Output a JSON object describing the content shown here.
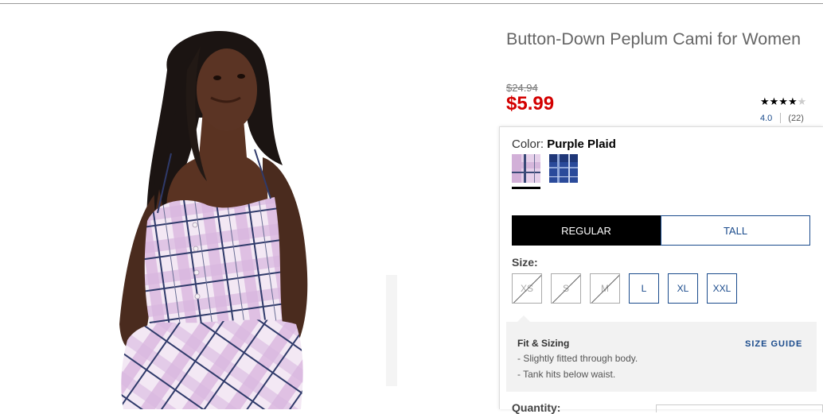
{
  "product": {
    "title": "Button-Down Peplum Cami for Women",
    "old_price": "$24.94",
    "sale_price": "$5.99",
    "rating": {
      "stars_value": 4.0,
      "stars_filled": "★★★★",
      "stars_empty": "★",
      "value_text": "4.0",
      "count_text": "(22)"
    }
  },
  "color": {
    "label": "Color:",
    "selected": "Purple Plaid",
    "swatches": [
      {
        "name": "Purple Plaid",
        "base": "#e6d0ea",
        "line": "#3b4a78"
      },
      {
        "name": "Blue Plaid",
        "base": "#2a4a9a",
        "line": "#8fa6d8"
      }
    ]
  },
  "fit": {
    "regular": "REGULAR",
    "tall": "TALL"
  },
  "size": {
    "label": "Size:",
    "options": [
      {
        "label": "XS",
        "available": false
      },
      {
        "label": "S",
        "available": false
      },
      {
        "label": "M",
        "available": false
      },
      {
        "label": "L",
        "available": true
      },
      {
        "label": "XL",
        "available": true
      },
      {
        "label": "XXL",
        "available": true
      }
    ]
  },
  "fit_sizing": {
    "title": "Fit & Sizing",
    "lines": [
      "- Slightly fitted through body.",
      "- Tank hits below waist."
    ],
    "guide_link": "SIZE GUIDE"
  },
  "quantity": {
    "label": "Quantity:"
  },
  "colors": {
    "sale_red": "#d30000",
    "link_blue": "#1a4b8c"
  }
}
